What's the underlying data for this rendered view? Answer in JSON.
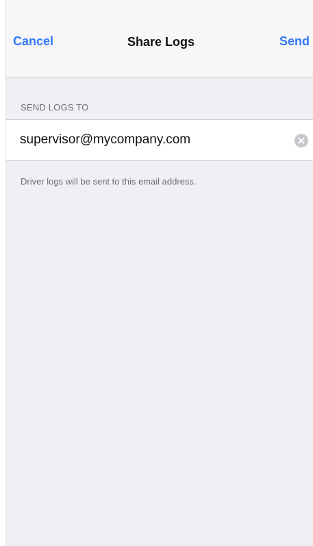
{
  "nav": {
    "cancel_label": "Cancel",
    "title": "Share Logs",
    "send_label": "Send"
  },
  "section": {
    "header": "SEND LOGS TO",
    "email_value": "supervisor@mycompany.com",
    "clear_icon": "clear-icon",
    "footer": "Driver logs will be sent to this email address."
  },
  "colors": {
    "accent": "#3478f6",
    "background": "#efeff4",
    "navbar": "#f7f7f8",
    "secondary_text": "#6d6d72"
  }
}
